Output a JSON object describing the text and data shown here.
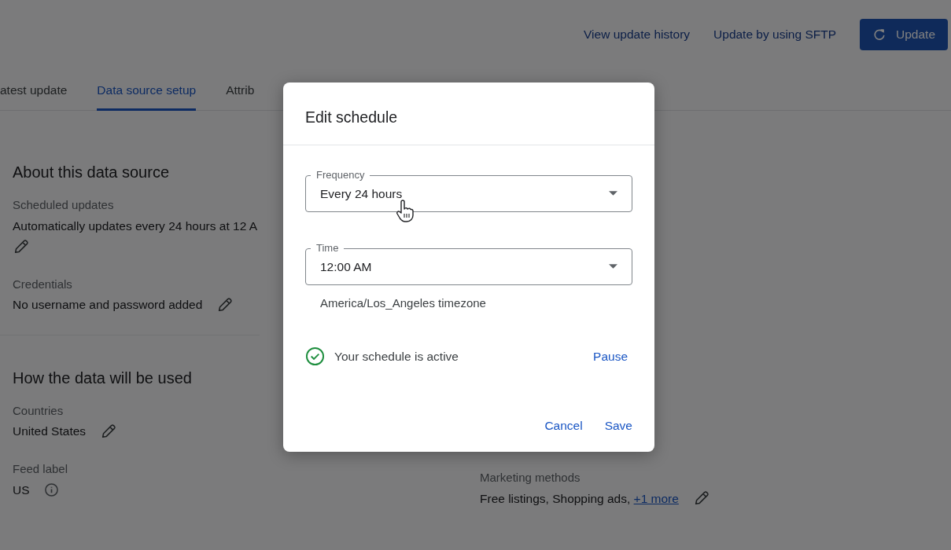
{
  "header_actions": [
    {
      "kind": "link",
      "label": "View update history"
    },
    {
      "kind": "link",
      "label": "Update by using SFTP"
    },
    {
      "kind": "button",
      "label": "Update"
    }
  ],
  "tabs": [
    {
      "label": "atest update",
      "selected": false
    },
    {
      "label": "Data source setup",
      "selected": true
    },
    {
      "label": "Attrib",
      "selected": false
    }
  ],
  "sections": [
    {
      "title": "About this data source",
      "fields": [
        {
          "label": "Scheduled updates",
          "value": "Automatically updates every 24 hours at 12 A",
          "editable": true
        },
        {
          "label": "Credentials",
          "value": "No username and password added",
          "editable": true
        }
      ]
    },
    {
      "title": "How the data will be used",
      "fields": [
        {
          "label": "Countries",
          "value": "United States",
          "editable": true
        },
        {
          "label": "Feed label",
          "value": "US",
          "info": true
        }
      ]
    }
  ],
  "right_fields": [
    {
      "label": "Marketing methods",
      "value": "Free listings, Shopping ads, ",
      "link": "+1 more",
      "editable": true
    }
  ],
  "dialog": {
    "title": "Edit schedule",
    "fields": [
      {
        "label": "Frequency",
        "value": "Every 24 hours"
      },
      {
        "label": "Time",
        "value": "12:00 AM"
      }
    ],
    "timezone": "America/Los_Angeles timezone",
    "status": {
      "text": "Your schedule is active",
      "active": true
    },
    "status_action": "Pause",
    "buttons": [
      "Cancel",
      "Save"
    ]
  }
}
